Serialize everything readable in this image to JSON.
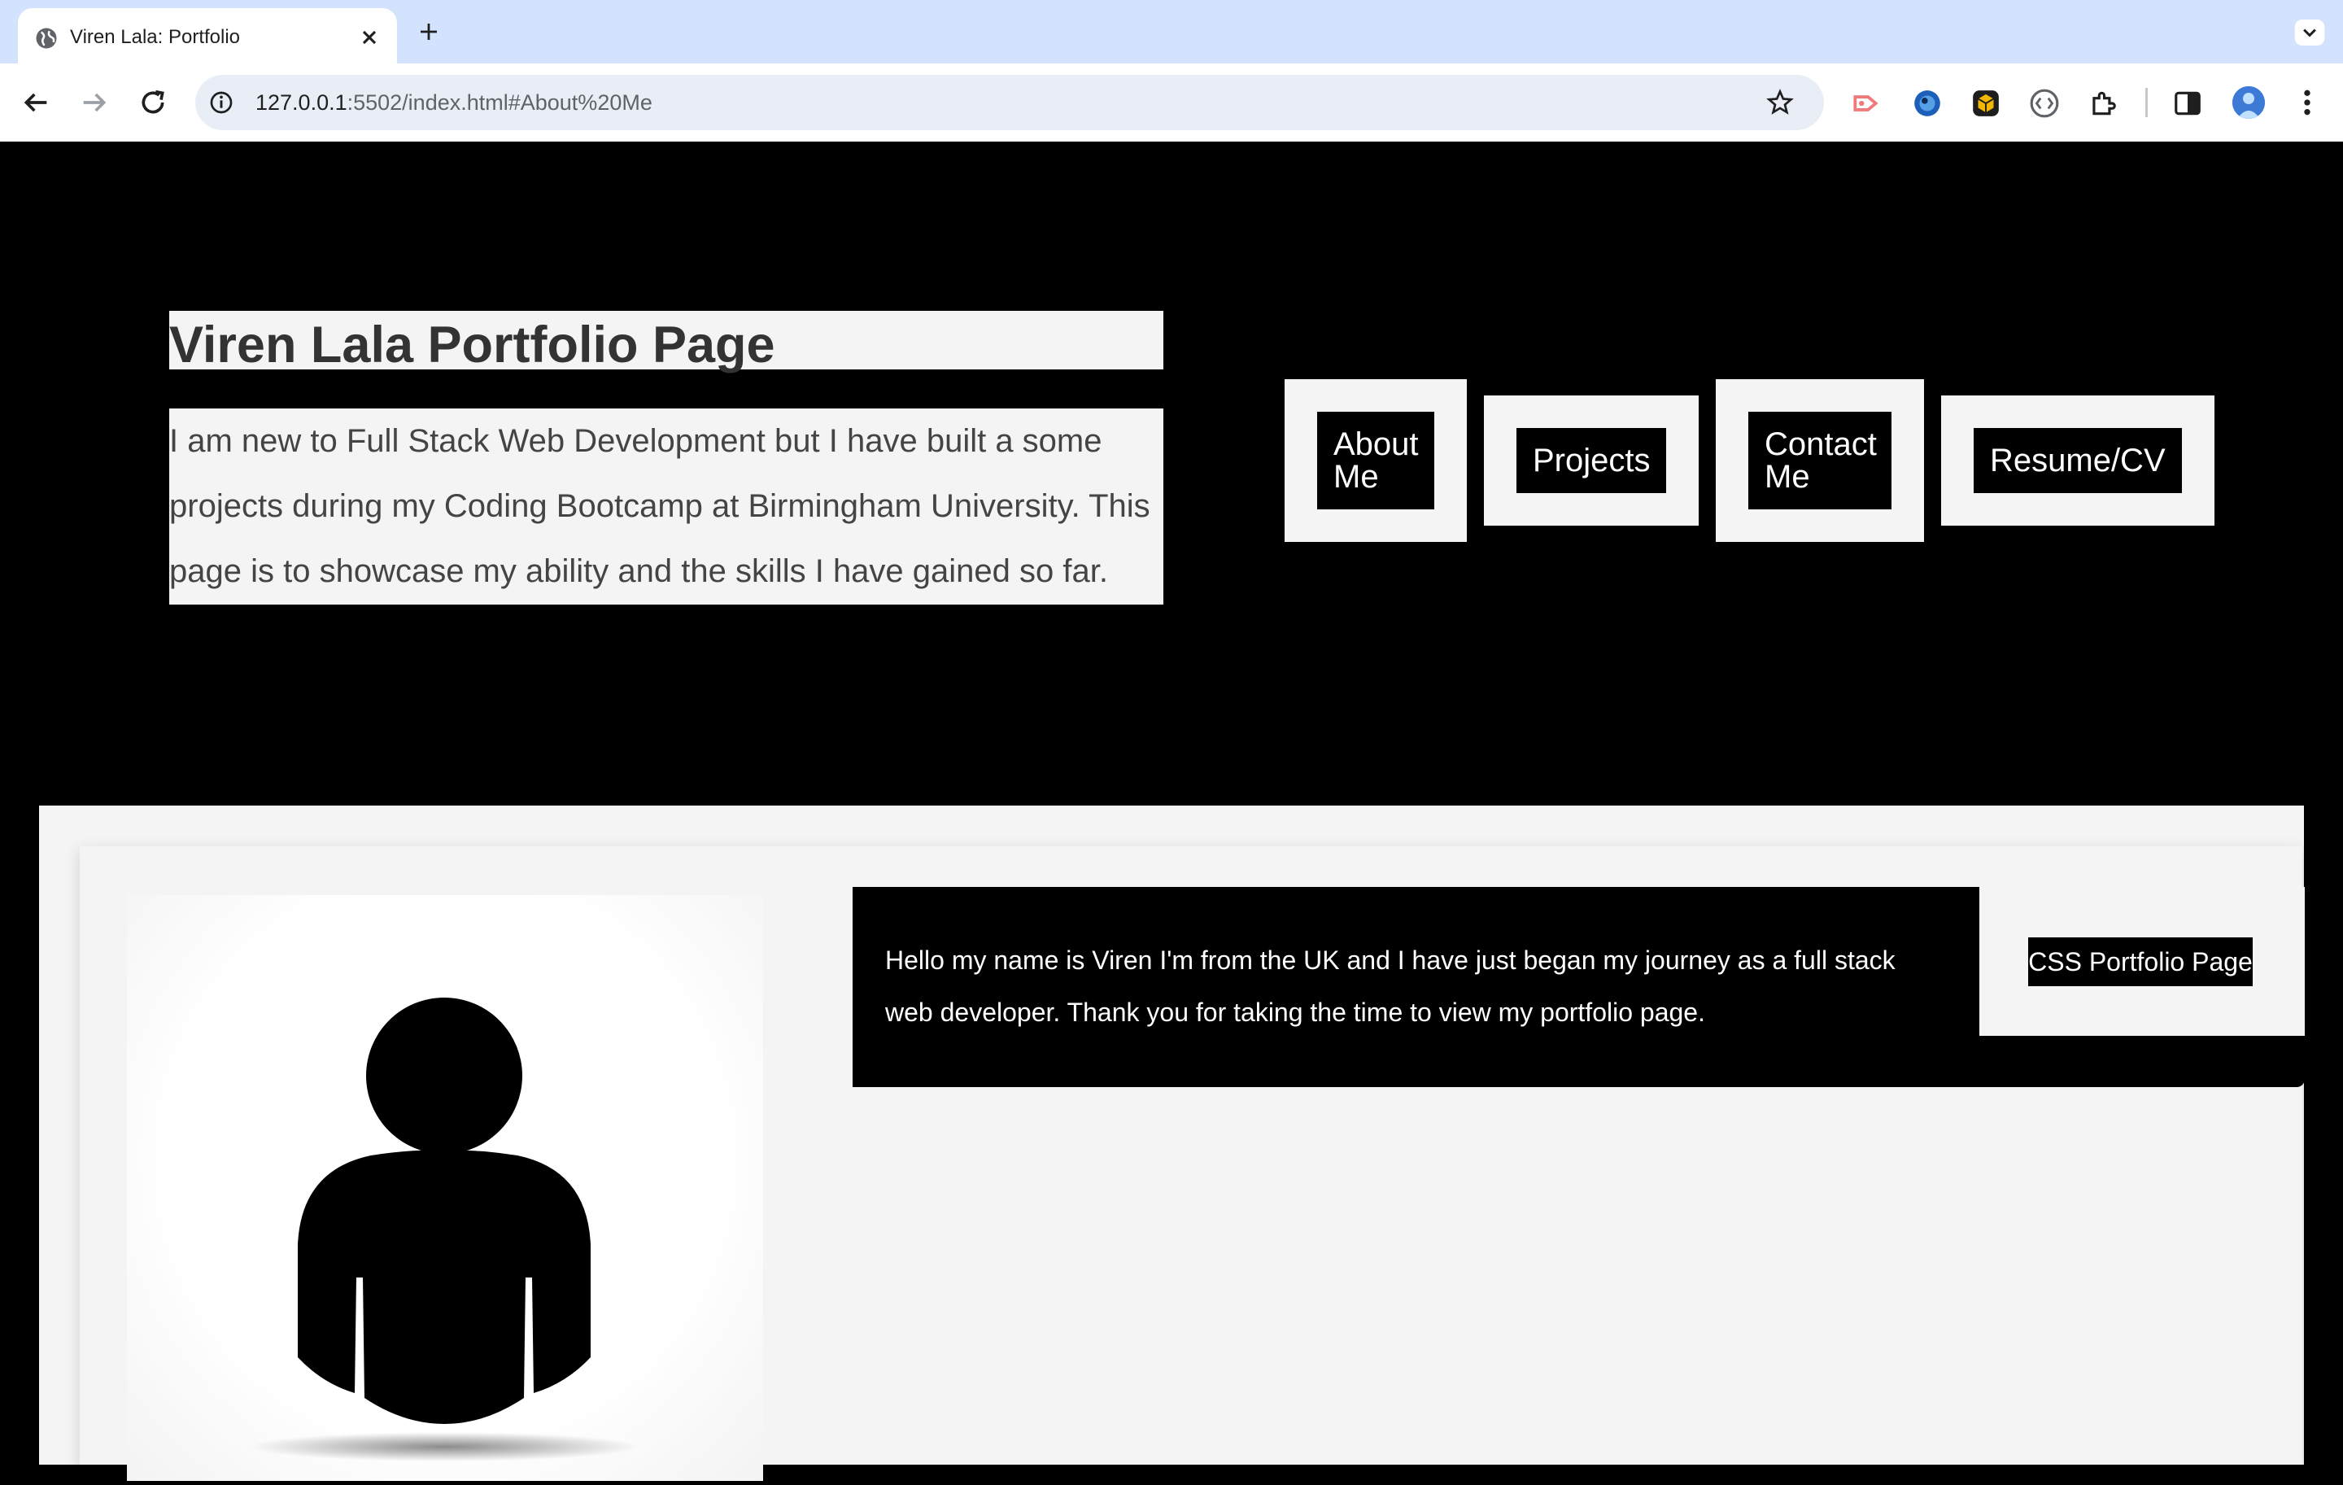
{
  "browser": {
    "tab_title": "Viren Lala: Portfolio",
    "url_host": "127.0.0.1",
    "url_rest": ":5502/index.html#About%20Me",
    "icons": [
      "globe-icon",
      "close-icon",
      "plus-icon",
      "chevron-down-icon",
      "back-icon",
      "forward-icon",
      "reload-icon",
      "site-info-icon",
      "star-icon",
      "extension-icons",
      "puzzle-icon",
      "side-panel-icon",
      "profile-avatar",
      "kebab-menu-icon"
    ]
  },
  "hero": {
    "title": "Viren Lala Portfolio Page",
    "description": "I am new to Full Stack Web Development but I have built a some projects during my Coding Bootcamp at Birmingham University. This page is to showcase my ability and the skills I have gained so far."
  },
  "nav": {
    "about_line1": "About",
    "about_line2": "Me",
    "projects": "Projects",
    "contact_line1": "Contact",
    "contact_line2": "Me",
    "resume": "Resume/CV"
  },
  "about": {
    "bio": "Hello my name is Viren I'm from the UK and I have just began my journey as a full stack web developer. Thank you for taking the time to view my portfolio page.",
    "css_link": "CSS Portfolio Page",
    "profile_image": "person-silhouette"
  },
  "colors": {
    "tabstrip": "#d3e3fd",
    "page_bg": "#000000",
    "panel_bg": "#f4f4f4",
    "title_text": "#333333"
  }
}
